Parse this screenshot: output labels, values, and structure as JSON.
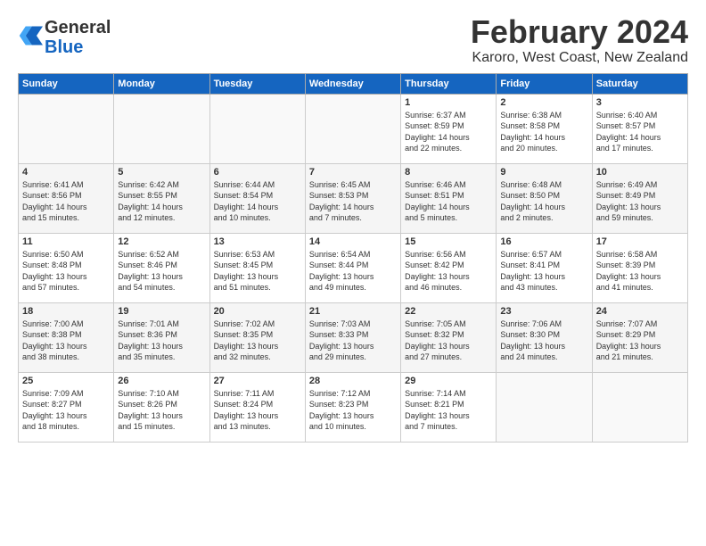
{
  "logo": {
    "text_general": "General",
    "text_blue": "Blue"
  },
  "header": {
    "title": "February 2024",
    "subtitle": "Karoro, West Coast, New Zealand"
  },
  "weekdays": [
    "Sunday",
    "Monday",
    "Tuesday",
    "Wednesday",
    "Thursday",
    "Friday",
    "Saturday"
  ],
  "weeks": [
    [
      {
        "day": "",
        "info": ""
      },
      {
        "day": "",
        "info": ""
      },
      {
        "day": "",
        "info": ""
      },
      {
        "day": "",
        "info": ""
      },
      {
        "day": "1",
        "info": "Sunrise: 6:37 AM\nSunset: 8:59 PM\nDaylight: 14 hours\nand 22 minutes."
      },
      {
        "day": "2",
        "info": "Sunrise: 6:38 AM\nSunset: 8:58 PM\nDaylight: 14 hours\nand 20 minutes."
      },
      {
        "day": "3",
        "info": "Sunrise: 6:40 AM\nSunset: 8:57 PM\nDaylight: 14 hours\nand 17 minutes."
      }
    ],
    [
      {
        "day": "4",
        "info": "Sunrise: 6:41 AM\nSunset: 8:56 PM\nDaylight: 14 hours\nand 15 minutes."
      },
      {
        "day": "5",
        "info": "Sunrise: 6:42 AM\nSunset: 8:55 PM\nDaylight: 14 hours\nand 12 minutes."
      },
      {
        "day": "6",
        "info": "Sunrise: 6:44 AM\nSunset: 8:54 PM\nDaylight: 14 hours\nand 10 minutes."
      },
      {
        "day": "7",
        "info": "Sunrise: 6:45 AM\nSunset: 8:53 PM\nDaylight: 14 hours\nand 7 minutes."
      },
      {
        "day": "8",
        "info": "Sunrise: 6:46 AM\nSunset: 8:51 PM\nDaylight: 14 hours\nand 5 minutes."
      },
      {
        "day": "9",
        "info": "Sunrise: 6:48 AM\nSunset: 8:50 PM\nDaylight: 14 hours\nand 2 minutes."
      },
      {
        "day": "10",
        "info": "Sunrise: 6:49 AM\nSunset: 8:49 PM\nDaylight: 13 hours\nand 59 minutes."
      }
    ],
    [
      {
        "day": "11",
        "info": "Sunrise: 6:50 AM\nSunset: 8:48 PM\nDaylight: 13 hours\nand 57 minutes."
      },
      {
        "day": "12",
        "info": "Sunrise: 6:52 AM\nSunset: 8:46 PM\nDaylight: 13 hours\nand 54 minutes."
      },
      {
        "day": "13",
        "info": "Sunrise: 6:53 AM\nSunset: 8:45 PM\nDaylight: 13 hours\nand 51 minutes."
      },
      {
        "day": "14",
        "info": "Sunrise: 6:54 AM\nSunset: 8:44 PM\nDaylight: 13 hours\nand 49 minutes."
      },
      {
        "day": "15",
        "info": "Sunrise: 6:56 AM\nSunset: 8:42 PM\nDaylight: 13 hours\nand 46 minutes."
      },
      {
        "day": "16",
        "info": "Sunrise: 6:57 AM\nSunset: 8:41 PM\nDaylight: 13 hours\nand 43 minutes."
      },
      {
        "day": "17",
        "info": "Sunrise: 6:58 AM\nSunset: 8:39 PM\nDaylight: 13 hours\nand 41 minutes."
      }
    ],
    [
      {
        "day": "18",
        "info": "Sunrise: 7:00 AM\nSunset: 8:38 PM\nDaylight: 13 hours\nand 38 minutes."
      },
      {
        "day": "19",
        "info": "Sunrise: 7:01 AM\nSunset: 8:36 PM\nDaylight: 13 hours\nand 35 minutes."
      },
      {
        "day": "20",
        "info": "Sunrise: 7:02 AM\nSunset: 8:35 PM\nDaylight: 13 hours\nand 32 minutes."
      },
      {
        "day": "21",
        "info": "Sunrise: 7:03 AM\nSunset: 8:33 PM\nDaylight: 13 hours\nand 29 minutes."
      },
      {
        "day": "22",
        "info": "Sunrise: 7:05 AM\nSunset: 8:32 PM\nDaylight: 13 hours\nand 27 minutes."
      },
      {
        "day": "23",
        "info": "Sunrise: 7:06 AM\nSunset: 8:30 PM\nDaylight: 13 hours\nand 24 minutes."
      },
      {
        "day": "24",
        "info": "Sunrise: 7:07 AM\nSunset: 8:29 PM\nDaylight: 13 hours\nand 21 minutes."
      }
    ],
    [
      {
        "day": "25",
        "info": "Sunrise: 7:09 AM\nSunset: 8:27 PM\nDaylight: 13 hours\nand 18 minutes."
      },
      {
        "day": "26",
        "info": "Sunrise: 7:10 AM\nSunset: 8:26 PM\nDaylight: 13 hours\nand 15 minutes."
      },
      {
        "day": "27",
        "info": "Sunrise: 7:11 AM\nSunset: 8:24 PM\nDaylight: 13 hours\nand 13 minutes."
      },
      {
        "day": "28",
        "info": "Sunrise: 7:12 AM\nSunset: 8:23 PM\nDaylight: 13 hours\nand 10 minutes."
      },
      {
        "day": "29",
        "info": "Sunrise: 7:14 AM\nSunset: 8:21 PM\nDaylight: 13 hours\nand 7 minutes."
      },
      {
        "day": "",
        "info": ""
      },
      {
        "day": "",
        "info": ""
      }
    ]
  ]
}
